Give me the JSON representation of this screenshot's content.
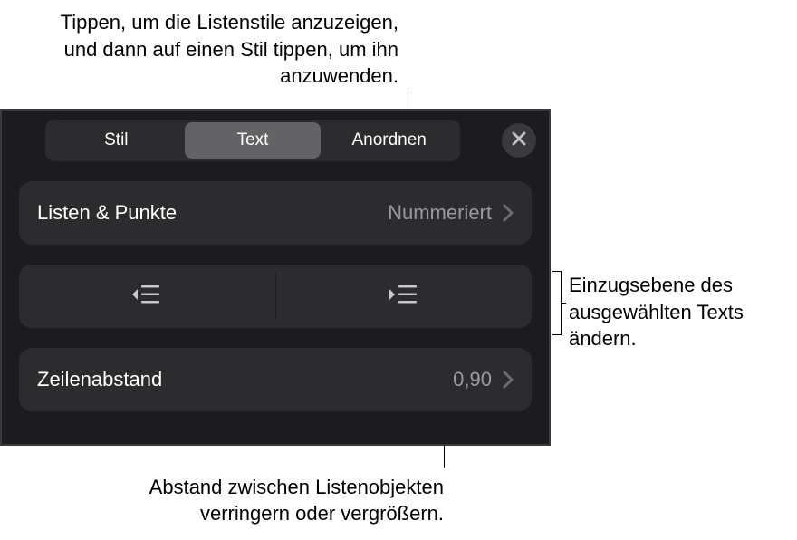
{
  "tabs": {
    "style": "Stil",
    "text": "Text",
    "arrange": "Anordnen"
  },
  "listsRow": {
    "label": "Listen & Punkte",
    "value": "Nummeriert"
  },
  "lineSpacingRow": {
    "label": "Zeilenabstand",
    "value": "0,90"
  },
  "annotations": {
    "top": "Tippen, um die Listenstile anzuzeigen, und dann auf einen Stil tippen, um ihn anzuwenden.",
    "right": "Einzugsebene des ausgewählten Texts ändern.",
    "bottom": "Abstand zwischen Listenobjekten verringern oder vergrößern."
  }
}
